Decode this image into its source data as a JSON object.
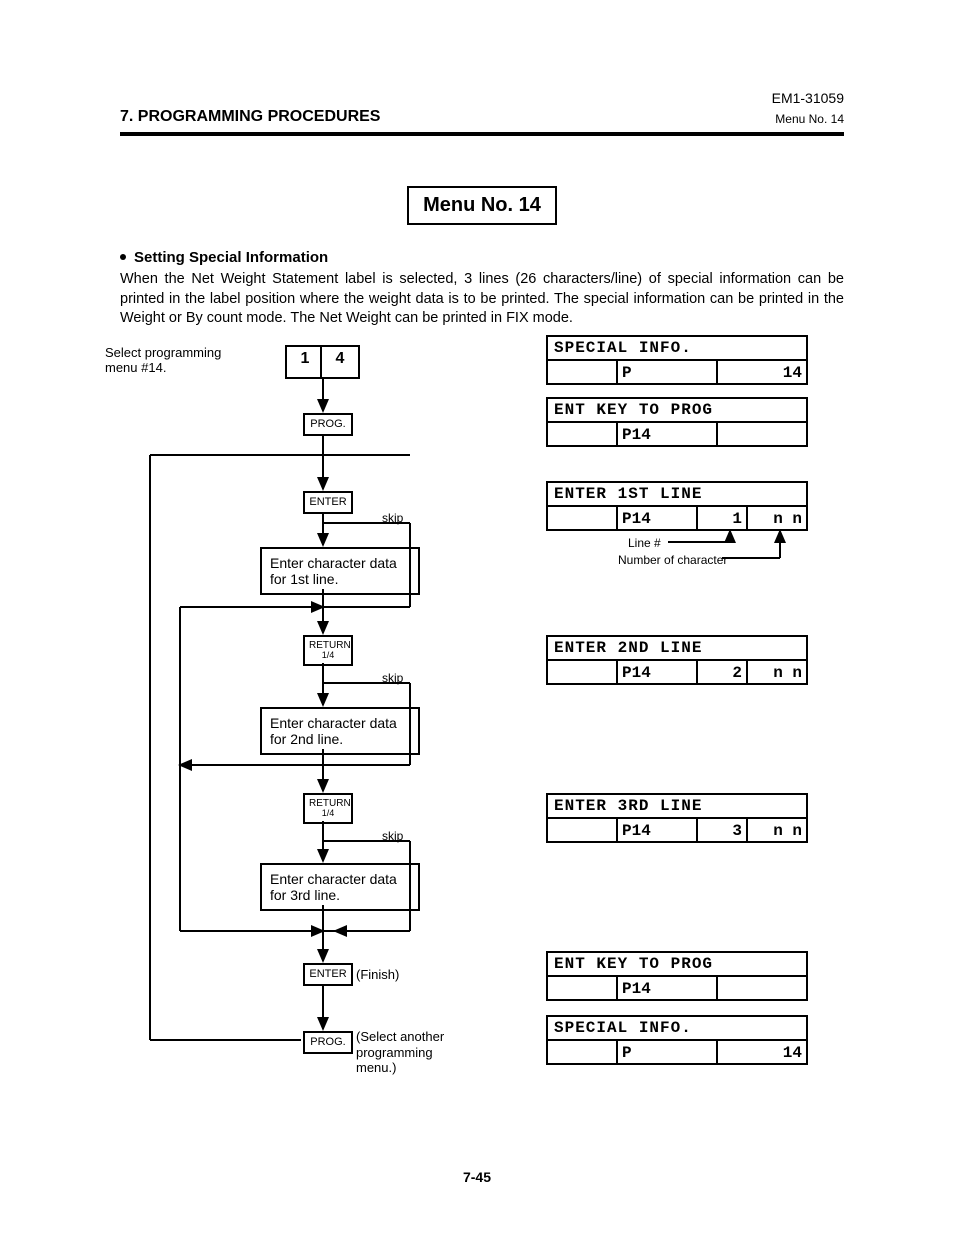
{
  "doc_ref": "EM1-31059",
  "section_title": "7. PROGRAMMING PROCEDURES",
  "menu_label_small": "Menu No. 14",
  "menu_title": "Menu No. 14",
  "subheading": "Setting Special Information",
  "body": "When the Net Weight Statement label is selected, 3 lines (26 characters/line) of special information can be printed in the label position where the weight data is to be printed. The special information can be printed in the Weight or By count mode. The Net Weight can be printed in FIX mode.",
  "page_num": "7-45",
  "flow": {
    "select_label": "Select programming menu #14.",
    "key1": "1",
    "key4": "4",
    "prog": "PROG.",
    "enter": "ENTER",
    "return": "RETURN",
    "return_sub": "1/4",
    "skip": "skip",
    "proc1": "Enter character data for 1st line.",
    "proc2": "Enter character data for 2nd line.",
    "proc3": "Enter character data for 3rd line.",
    "finish": "(Finish)",
    "select_another": "(Select another programming menu.)"
  },
  "displays": {
    "d1_top": "SPECIAL INFO.",
    "d1_c2": "P",
    "d1_c3": "14",
    "d2_top": "ENT KEY TO PROG",
    "d2_c2": "P14",
    "d3_top": "ENTER 1ST LINE",
    "d3_c2": "P14",
    "d3_c3": "1",
    "d3_c4": "n n",
    "d3_ann1": "Line #",
    "d3_ann2": "Number of character",
    "d4_top": "ENTER 2ND LINE",
    "d4_c2": "P14",
    "d4_c3": "2",
    "d4_c4": "n n",
    "d5_top": "ENTER 3RD LINE",
    "d5_c2": "P14",
    "d5_c3": "3",
    "d5_c4": "n n",
    "d6_top": "ENT KEY TO PROG",
    "d6_c2": "P14",
    "d7_top": "SPECIAL INFO.",
    "d7_c2": "P",
    "d7_c3": "14"
  }
}
